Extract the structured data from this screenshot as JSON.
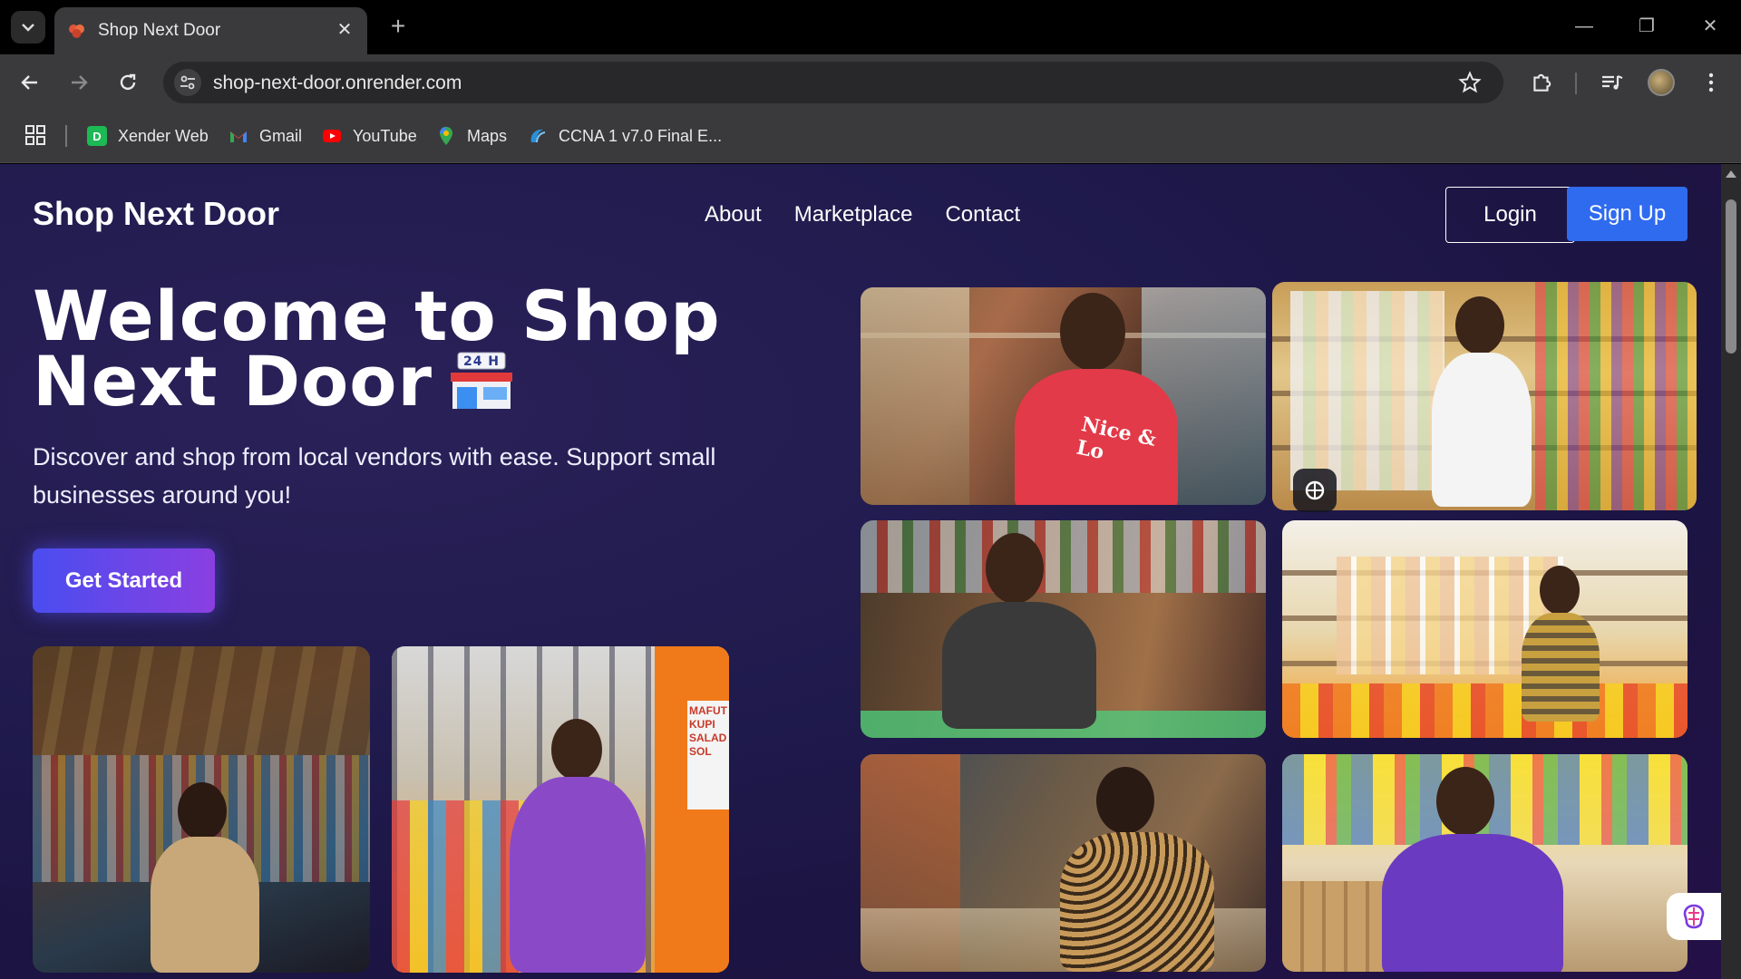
{
  "browser": {
    "tab_title": "Shop Next Door",
    "url": "shop-next-door.onrender.com",
    "bookmarks": [
      {
        "label": "Xender Web",
        "icon": "xender-icon"
      },
      {
        "label": "Gmail",
        "icon": "gmail-icon"
      },
      {
        "label": "YouTube",
        "icon": "youtube-icon"
      },
      {
        "label": "Maps",
        "icon": "maps-icon"
      },
      {
        "label": "CCNA 1 v7.0 Final E...",
        "icon": "ccna-icon"
      }
    ]
  },
  "site": {
    "brand": "Shop Next Door",
    "nav": [
      "About",
      "Marketplace",
      "Contact"
    ],
    "login_label": "Login",
    "signup_label": "Sign Up"
  },
  "hero": {
    "title_line1": "Welcome to Shop",
    "title_line2": "Next Door",
    "store_sign": "24 H",
    "subtitle": "Discover and shop from local vendors with ease. Support small businesses around you!",
    "cta_label": "Get Started"
  },
  "photos": [
    {
      "name": "vendor-waving-photo",
      "shirt_text": "Nice & Lo"
    },
    {
      "name": "vendor-shelves-photo"
    },
    {
      "name": "vendor-counter-photo"
    },
    {
      "name": "vendor-yellow-shelves-photo"
    },
    {
      "name": "vendor-phone-photo"
    },
    {
      "name": "vendor-purple-coat-photo"
    },
    {
      "name": "market-stall-night-photo"
    },
    {
      "name": "kiosk-purple-coat-photo",
      "sign_text": "MAFUT KUPI SALAD SOL"
    }
  ],
  "colors": {
    "accent_blue": "#2f6bef",
    "cta_gradient_start": "#4a4df0",
    "cta_gradient_end": "#8a3fe0",
    "background": "#1f1a4c"
  }
}
